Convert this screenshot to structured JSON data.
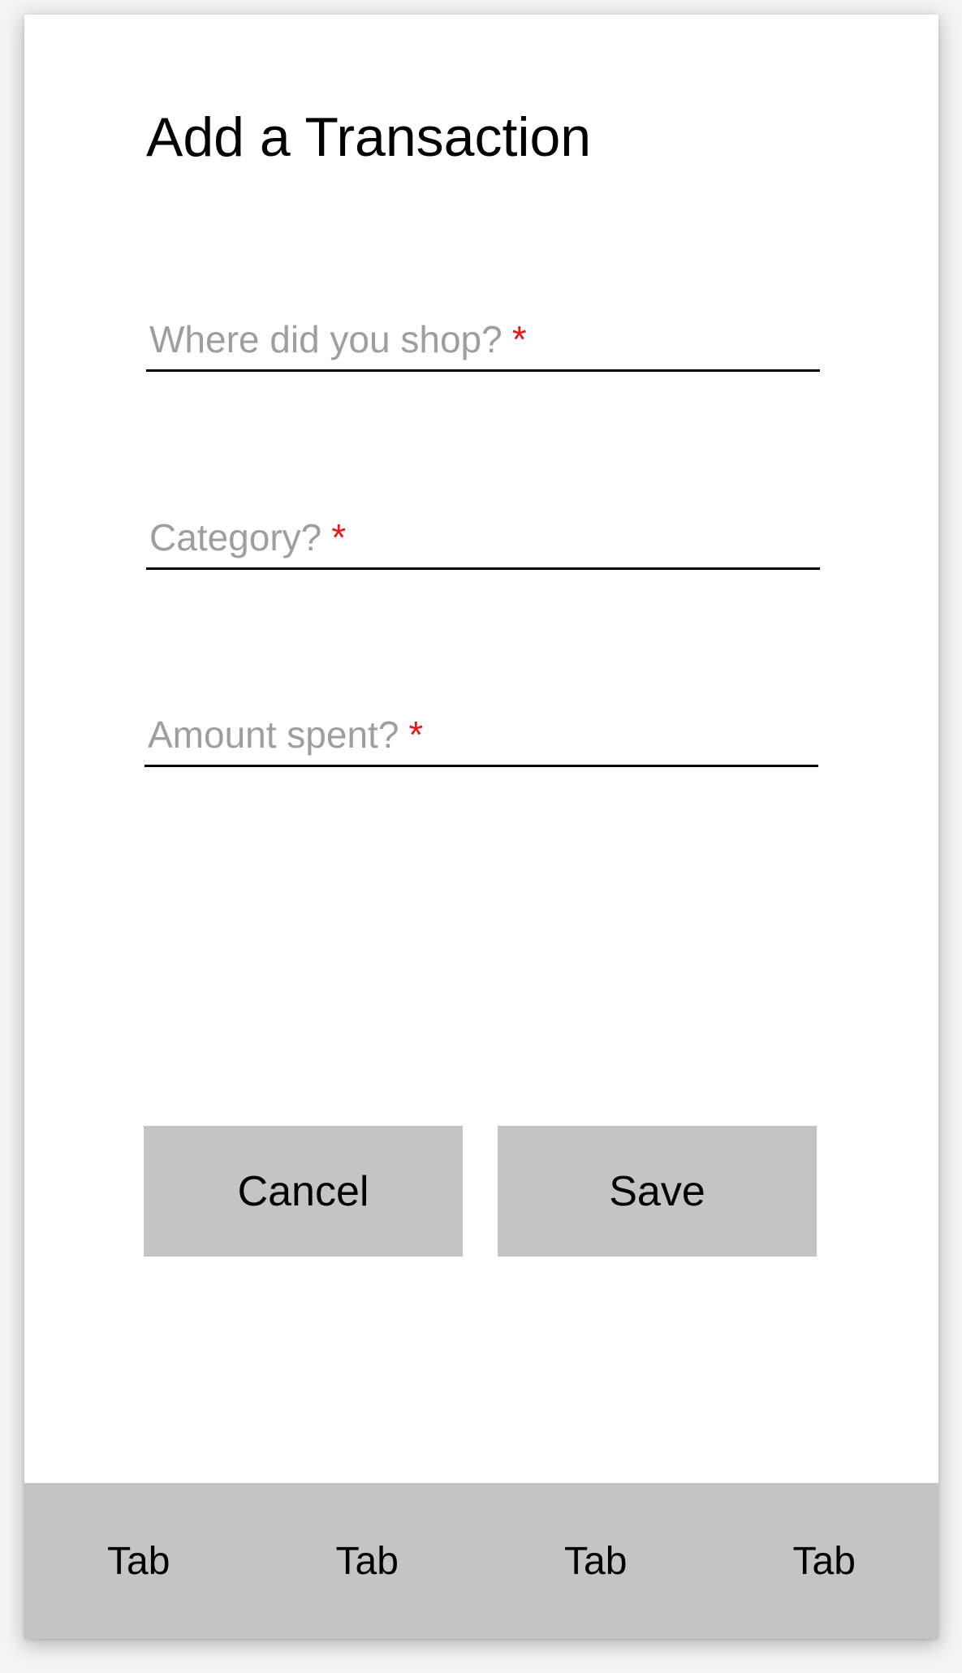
{
  "header": {
    "title": "Add a Transaction"
  },
  "form": {
    "fields": [
      {
        "placeholder": "Where did you shop?",
        "required_mark": "*",
        "value": ""
      },
      {
        "placeholder": "Category?",
        "required_mark": "*",
        "value": ""
      },
      {
        "placeholder": "Amount spent?",
        "required_mark": "*",
        "value": ""
      }
    ]
  },
  "actions": {
    "cancel_label": "Cancel",
    "save_label": "Save"
  },
  "tabbar": {
    "tabs": [
      {
        "label": "Tab"
      },
      {
        "label": "Tab"
      },
      {
        "label": "Tab"
      },
      {
        "label": "Tab"
      }
    ]
  },
  "colors": {
    "required": "#e41a1a",
    "placeholder": "#9e9e9e",
    "button_bg": "#c4c4c4",
    "tabbar_bg": "#c4c4c4"
  }
}
